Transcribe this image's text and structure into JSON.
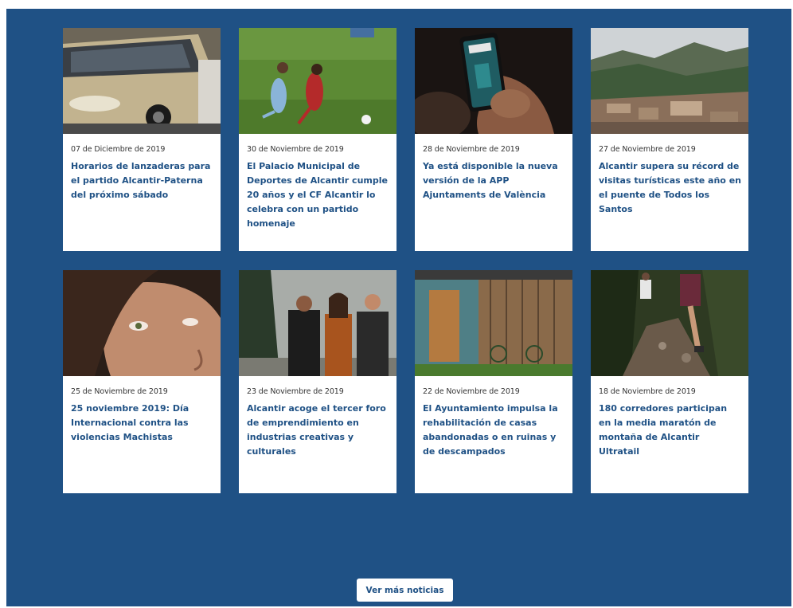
{
  "news": [
    {
      "date": "07 de Diciembre de 2019",
      "title": "Horarios de lanzaderas para el partido Alcantir-Paterna del próximo sábado",
      "image": "bus-photo"
    },
    {
      "date": "30 de Noviembre de 2019",
      "title": "El Palacio Municipal de Deportes de Alcantir cumple 20 años y el CF Alcantir lo celebra con un partido homenaje",
      "image": "football-players-photo"
    },
    {
      "date": "28 de Noviembre de 2019",
      "title": "Ya está disponible la nueva versión de la APP Ajuntaments de València",
      "image": "phone-app-photo"
    },
    {
      "date": "27 de Noviembre de 2019",
      "title": "Alcantir supera su récord de visitas turísticas este año en el puente de Todos los Santos",
      "image": "mountain-town-photo"
    },
    {
      "date": "25 de Noviembre de 2019",
      "title": "25 noviembre 2019: Día Internacional contra las violencias Machistas",
      "image": "woman-face-photo"
    },
    {
      "date": "23 de Noviembre de 2019",
      "title": "Alcantir acoge el tercer foro de emprendimiento en industrias creativas y culturales",
      "image": "three-people-photo"
    },
    {
      "date": "22 de Noviembre de 2019",
      "title": "El Ayuntamiento impulsa la rehabilitación de casas abandonadas o en ruinas y de descampados",
      "image": "wooden-house-photo"
    },
    {
      "date": "18 de Noviembre de 2019",
      "title": "180 corredores participan en la media maratón de montaña de Alcantir Ultratail",
      "image": "trail-runners-photo"
    }
  ],
  "more_button": "Ver más noticias",
  "colors": {
    "background": "#1f5185",
    "card": "#ffffff",
    "title": "#1f5185"
  }
}
